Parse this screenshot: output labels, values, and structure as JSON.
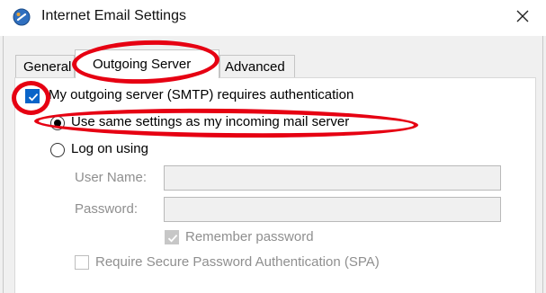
{
  "window": {
    "title": "Internet Email Settings",
    "close_icon": "close-icon",
    "app_icon": "outlook-settings-icon"
  },
  "tabs": [
    {
      "label": "General",
      "active": false
    },
    {
      "label": "Outgoing Server",
      "active": true
    },
    {
      "label": "Advanced",
      "active": false
    }
  ],
  "outgoing": {
    "requires_auth_label": "My outgoing server (SMTP) requires authentication",
    "requires_auth_checked": true,
    "use_same_label": "Use same settings as my incoming mail server",
    "use_same_selected": true,
    "log_on_label": "Log on using",
    "log_on_selected": false,
    "username_label": "User Name:",
    "username_value": "",
    "password_label": "Password:",
    "password_value": "",
    "remember_password_label": "Remember password",
    "remember_password_checked": true,
    "spa_label": "Require Secure Password Authentication (SPA)",
    "spa_checked": false
  },
  "colors": {
    "annotation": "#e60012",
    "checkbox_accent": "#0a64c8"
  }
}
